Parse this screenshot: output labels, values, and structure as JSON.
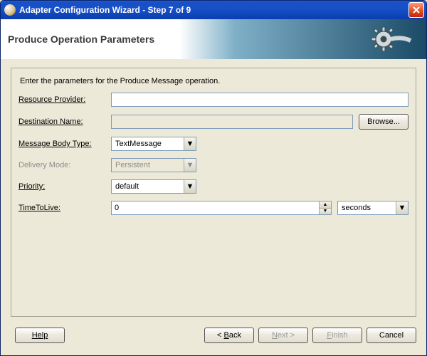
{
  "titlebar": {
    "title": "Adapter Configuration Wizard - Step 7 of 9"
  },
  "banner": {
    "title": "Produce Operation Parameters"
  },
  "instruction": "Enter the parameters for the Produce Message operation.",
  "labels": {
    "resourceProvider": "Resource Provider:",
    "destinationName": "Destination Name:",
    "messageBodyType": "Message Body Type:",
    "deliveryMode": "Delivery Mode:",
    "priority": "Priority:",
    "timeToLive": "TimeToLive:"
  },
  "fields": {
    "resourceProvider": "",
    "destinationName": "",
    "messageBodyType": "TextMessage",
    "deliveryMode": "Persistent",
    "priority": "default",
    "timeToLive": "0",
    "timeUnit": "seconds"
  },
  "buttons": {
    "browse": "Browse...",
    "help": "Help",
    "back_prefix": "< ",
    "back_mn": "B",
    "back_rest": "ack",
    "next_mn": "N",
    "next_rest": "ext >",
    "finish_mn": "F",
    "finish_rest": "inish",
    "cancel": "Cancel"
  }
}
